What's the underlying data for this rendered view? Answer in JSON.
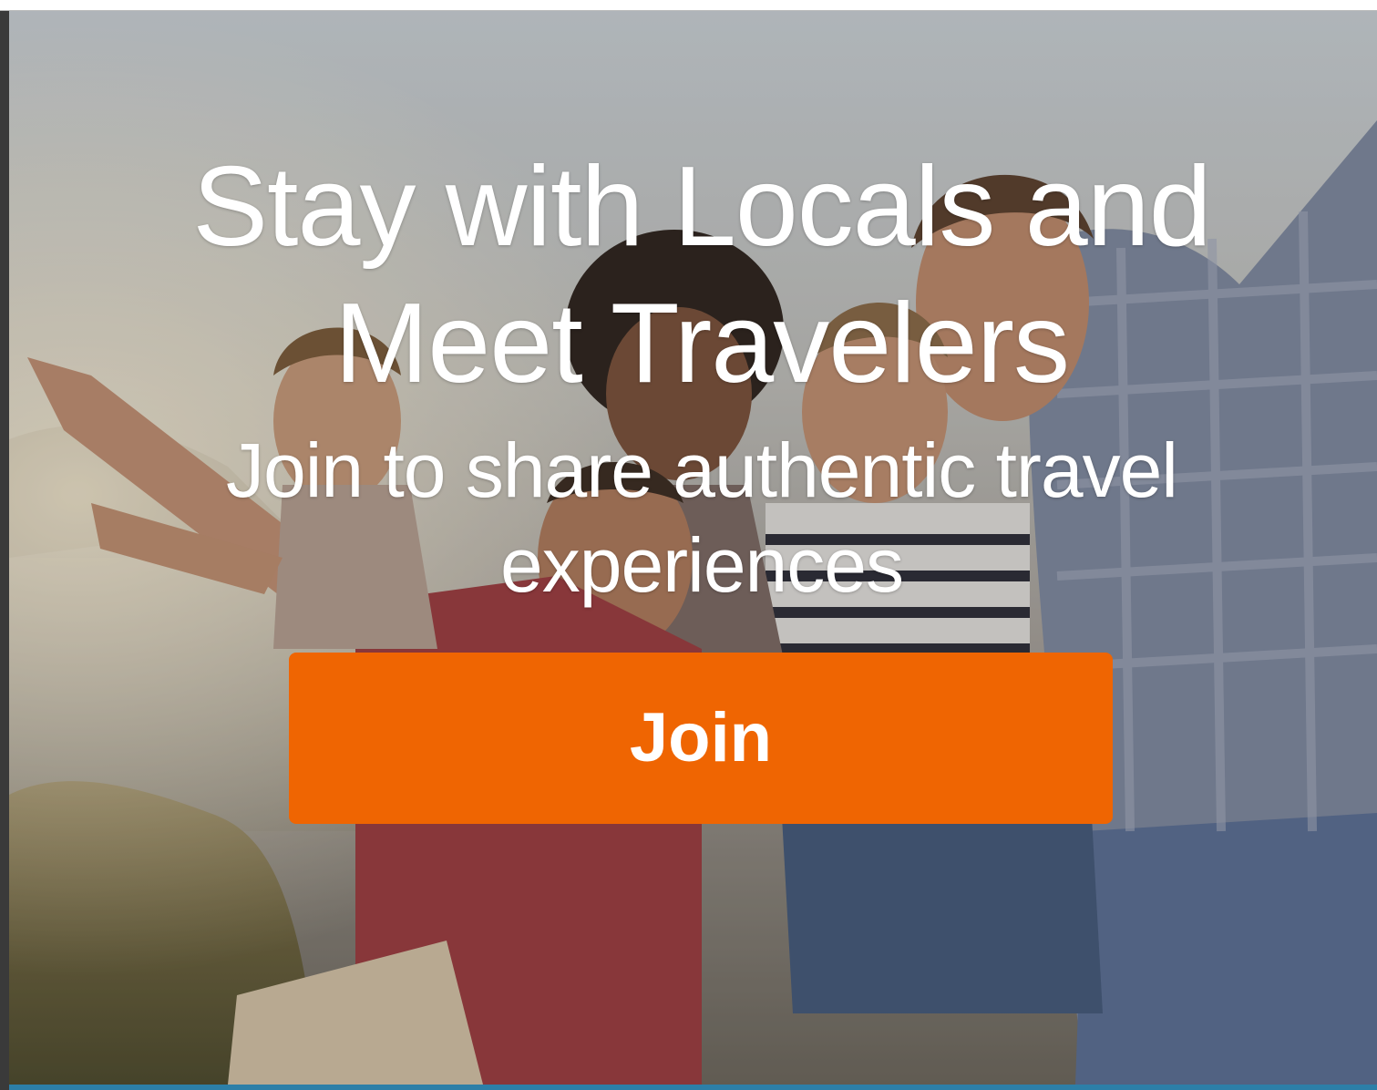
{
  "hero": {
    "headline_line1": "Stay with Locals and",
    "headline_line2": "Meet Travelers",
    "subhead_line1": "Join to share authentic travel",
    "subhead_line2": "experiences",
    "join_label": "Join"
  },
  "colors": {
    "button_bg": "#ef6502",
    "text": "#ffffff",
    "bottom_bar": "#2c7fa8"
  }
}
